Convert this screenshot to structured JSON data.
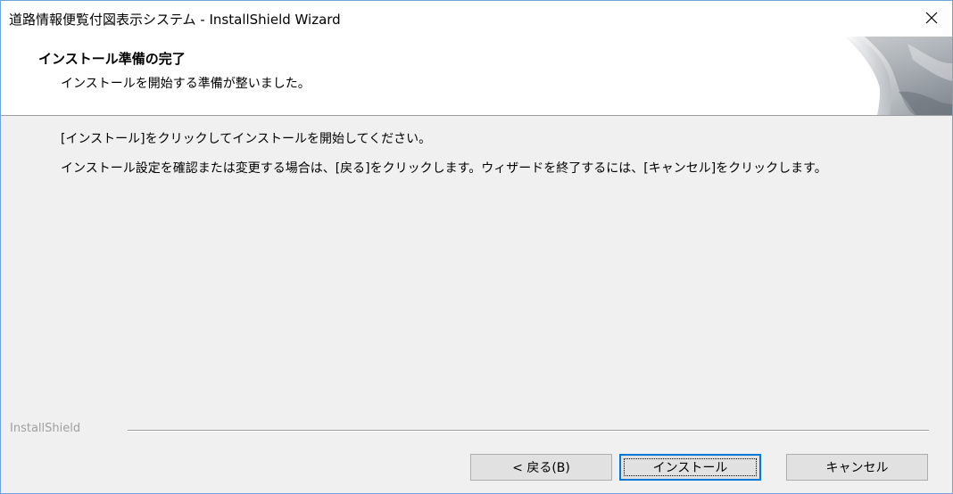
{
  "window": {
    "title": "道路情報便覧付図表示システム - InstallShield Wizard"
  },
  "header": {
    "title": "インストール準備の完了",
    "subtitle": "インストールを開始する準備が整いました。"
  },
  "content": {
    "line1": "[インストール]をクリックしてインストールを開始してください。",
    "line2": "インストール設定を確認または変更する場合は、[戻る]をクリックします。ウィザードを終了するには、[キャンセル]をクリックします。"
  },
  "footer": {
    "brand": "InstallShield",
    "back_label": "< 戻る(B)",
    "install_label": "インストール",
    "cancel_label": "キャンセル"
  },
  "colors": {
    "window_border": "#6fa4d8",
    "dialog_bg": "#f0f0f0",
    "focus_blue": "#0078d7"
  },
  "icons": {
    "close": "close-icon",
    "header_art": "page-curl-graphic"
  }
}
